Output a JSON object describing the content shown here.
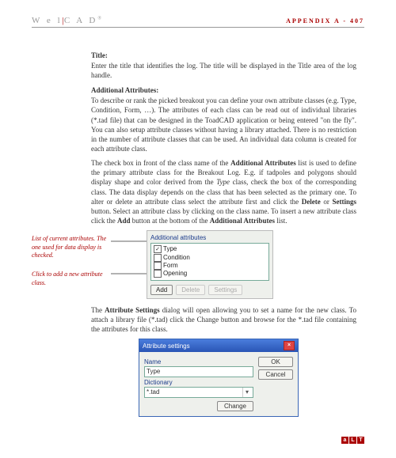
{
  "header": {
    "brand_left": "W e l",
    "brand_sep": "|",
    "brand_right": "C A D",
    "appendix": "APPENDIX A - 407"
  },
  "body": {
    "title_label": "Title",
    "title_text": "Enter the title that identifies the log. The title will be displayed in the Title area of the log handle.",
    "attr_label": "Additional Attributes",
    "para1": "To describe or rank the picked breakout you can define your own attribute classes (e.g. Type, Condition, Form, …). The attributes of each class can be read out of individual libraries (*.tad file) that can be designed in the ToadCAD application or being entered \"on the fly\". You can also setup attribute classes without having a library attached. There is no restriction in the number of attribute classes that can be used. An individual data column is created for each attribute class.",
    "para2a": "The check box in front of the class name of the ",
    "para2b": "Additional Attributes",
    "para2c": " list is used to define the primary attribute class for the Breakout Log. E.g. if tadpoles and polygons should display shape and color derived from the ",
    "para2d": "Type",
    "para2e": " class, check the box of the corresponding class. The data display depends on the class that has been selected as the primary one. To alter or delete an attribute class select the attribute first and click the ",
    "para2f": "Delete",
    "para2g": " or ",
    "para2h": "Settings",
    "para2i": " button. Select an attribute class by clicking on the class name. To insert a new attribute class click the ",
    "para2j": "Add",
    "para2k": " button at the bottom of the ",
    "para2l": "Additional Attributes",
    "para2m": " list.",
    "caption1": "List of current attributes. The one used for data display is checked.",
    "caption2": "Click to add a new attribute class.",
    "para3a": "The ",
    "para3b": "Attribute Settings",
    "para3c": " dialog will open allowing you to set a name for the new class. To attach a library file (*.tad) click the Change button and browse for the *.tad file containing the attributes for this class."
  },
  "panel": {
    "title": "Additional attributes",
    "items": [
      {
        "label": "Type",
        "checked": true
      },
      {
        "label": "Condition",
        "checked": false
      },
      {
        "label": "Form",
        "checked": false
      },
      {
        "label": "Opening",
        "checked": false
      }
    ],
    "btn_add": "Add",
    "btn_delete": "Delete",
    "btn_settings": "Settings"
  },
  "dialog": {
    "title": "Attribute settings",
    "lbl_name": "Name",
    "val_name": "Type",
    "lbl_dict": "Dictionary",
    "val_dict": "*.tad",
    "btn_ok": "OK",
    "btn_cancel": "Cancel",
    "btn_change": "Change"
  },
  "footer": {
    "a": "a",
    "l": "L",
    "t": "T"
  }
}
